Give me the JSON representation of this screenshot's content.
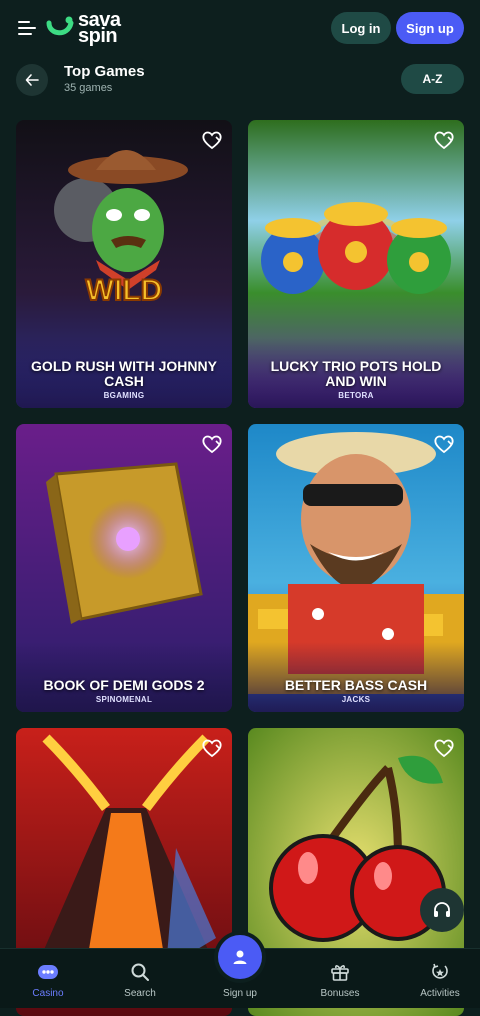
{
  "header": {
    "logo_line1": "sava",
    "logo_line2": "spin",
    "login_label": "Log in",
    "signup_label": "Sign up"
  },
  "section": {
    "title": "Top Games",
    "count": "35 games",
    "sort_label": "A-Z"
  },
  "games": [
    {
      "name": "GOLD RUSH WITH JOHNNY CASH",
      "provider": "BGAMING"
    },
    {
      "name": "LUCKY TRIO POTS HOLD AND WIN",
      "provider": "BETORA"
    },
    {
      "name": "BOOK OF DEMI GODS 2",
      "provider": "SPINOMENAL"
    },
    {
      "name": "BETTER BASS CASH",
      "provider": "JACKS"
    },
    {
      "name": "",
      "provider": ""
    },
    {
      "name": "",
      "provider": ""
    }
  ],
  "nav": {
    "casino": "Casino",
    "search": "Search",
    "signup": "Sign up",
    "bonuses": "Bonuses",
    "activities": "Activities"
  },
  "colors": {
    "background": "#0d1f1e",
    "accent": "#4b5bf5",
    "brand_green": "#3ddc84"
  }
}
